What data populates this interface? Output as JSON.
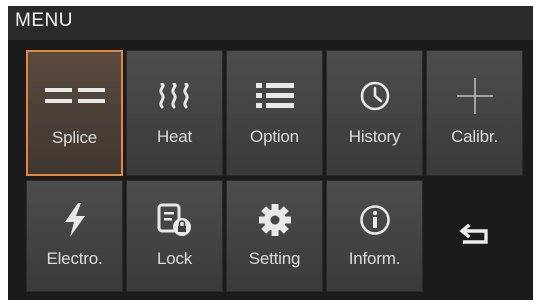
{
  "header": {
    "title": "MENU"
  },
  "menu": {
    "items": [
      {
        "label": "Splice",
        "icon": "splice-icon",
        "selected": true
      },
      {
        "label": "Heat",
        "icon": "heat-icon"
      },
      {
        "label": "Option",
        "icon": "list-icon"
      },
      {
        "label": "History",
        "icon": "clock-icon"
      },
      {
        "label": "Calibr.",
        "icon": "crosshair-icon"
      },
      {
        "label": "Electro.",
        "icon": "lightning-icon"
      },
      {
        "label": "Lock",
        "icon": "lock-document-icon"
      },
      {
        "label": "Setting",
        "icon": "gear-icon"
      },
      {
        "label": "Inform.",
        "icon": "info-icon"
      }
    ],
    "back_icon": "return-arrow-icon"
  },
  "colors": {
    "selected_border": "#e2883e",
    "tile_background": "#444444",
    "screen_background": "#1b1b1b"
  }
}
